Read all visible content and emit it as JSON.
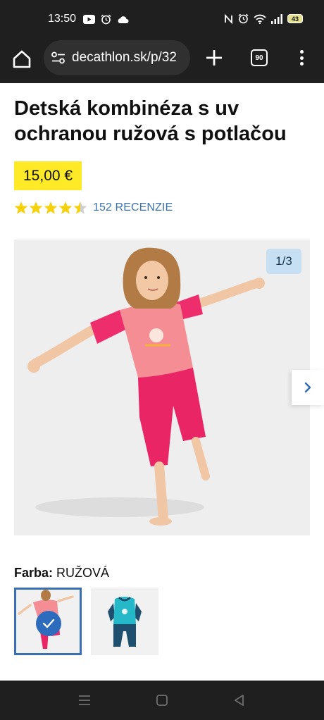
{
  "status": {
    "time": "13:50",
    "battery": "43",
    "left_icons": [
      "youtube-icon",
      "alarm-icon",
      "cloud-icon"
    ],
    "right_icons": [
      "nfc-icon",
      "alarm-icon",
      "wifi-icon",
      "signal-icon",
      "battery-icon"
    ]
  },
  "browser": {
    "url": "decathlon.sk/p/32",
    "tab_count": "90",
    "icons": [
      "home-icon",
      "site-settings-icon",
      "plus-icon",
      "tabs-icon",
      "more-vert-icon"
    ]
  },
  "product": {
    "title": "Detská kombinéza s uv ochranou ružová s potlačou",
    "price": "15,00 €",
    "rating": 4.5,
    "rating_max": 5,
    "reviews_label": "152 RECENZIE",
    "accent_color": "#ffea28",
    "link_color": "#3a74ad"
  },
  "gallery": {
    "counter": "1/3",
    "next_icon": "chevron-right-icon"
  },
  "color_selector": {
    "label": "Farba:",
    "value": "RUŽOVÁ",
    "options": [
      {
        "name": "pink",
        "selected": true
      },
      {
        "name": "blue",
        "selected": false
      }
    ]
  },
  "nav": {
    "icons": [
      "recent-apps-icon",
      "home-square-icon",
      "back-icon"
    ]
  }
}
